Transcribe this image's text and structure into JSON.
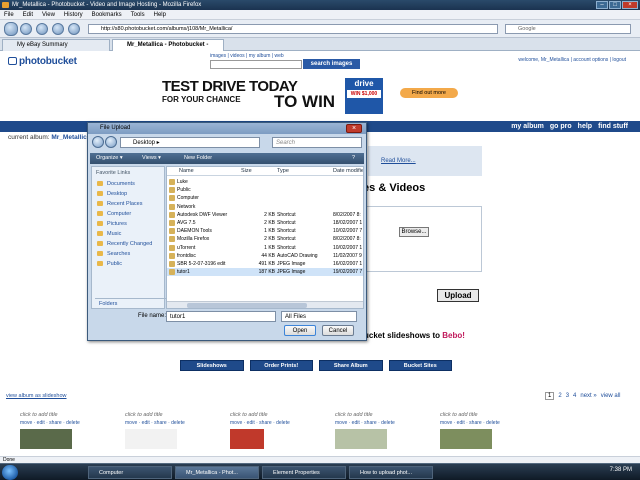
{
  "browser": {
    "window_title": "Mr_Metallica - Photobucket - Video and Image Hosting - Mozilla Firefox",
    "menu": [
      "File",
      "Edit",
      "View",
      "History",
      "Bookmarks",
      "Tools",
      "Help"
    ],
    "url": "http://s80.photobucket.com/albums/j108/Mr_Metallica/",
    "search_placeholder": "Google",
    "tabs": [
      "My eBay Summary",
      "Mr_Metallica - Photobucket - Vid..."
    ],
    "status": "Done"
  },
  "site": {
    "logo": "photobucket",
    "top_links": "images | videos | my album | web",
    "search_button": "search images",
    "welcome": "welcome, Mr_Metallica | account options | logout",
    "nav": [
      "my album",
      "go pro",
      "help",
      "find stuff"
    ],
    "current_album_label": "current album:",
    "current_album": "Mr_Metallica",
    "read_more": "Read More...",
    "videos_heading": "ies & Videos",
    "browse": "Browse...",
    "upload": "Upload",
    "bebo_text": "ucket slideshows to ",
    "bebo_brand": "Bebo!",
    "action_buttons": [
      "Slideshows",
      "Order Prints!",
      "Share Album",
      "Bucket Sites"
    ],
    "view_slideshow": "view album as slideshow",
    "pager": [
      "1",
      "2",
      "3",
      "4",
      "next »",
      "view all"
    ],
    "thumb_title": "click to add title",
    "thumb_ops": "move · edit · share · delete"
  },
  "ad": {
    "line1": "TEST DRIVE TODAY",
    "line2": "FOR YOUR CHANCE",
    "line3": "TO WIN",
    "logo": "drive",
    "logo_sub": "WIN $1,000",
    "cta": "Find out more"
  },
  "dialog": {
    "title": "File Upload",
    "address": "Desktop ▸",
    "search": "Search",
    "toolbar": [
      "Organize ▾",
      "Views ▾",
      "New Folder"
    ],
    "favorites_header": "Favorite Links",
    "favorites": [
      "Documents",
      "Desktop",
      "Recent Places",
      "Computer",
      "Pictures",
      "Music",
      "Recently Changed",
      "Searches",
      "Public"
    ],
    "folders": "Folders",
    "columns": [
      "Name",
      "Size",
      "Type",
      "Date modifie"
    ],
    "files": [
      {
        "name": "Luke",
        "size": "",
        "type": "",
        "date": ""
      },
      {
        "name": "Public",
        "size": "",
        "type": "",
        "date": ""
      },
      {
        "name": "Computer",
        "size": "",
        "type": "",
        "date": ""
      },
      {
        "name": "Network",
        "size": "",
        "type": "",
        "date": ""
      },
      {
        "name": "Autodesk DWF Viewer",
        "size": "2 KB",
        "type": "Shortcut",
        "date": "8/02/2007 8:"
      },
      {
        "name": "AVG 7.5",
        "size": "2 KB",
        "type": "Shortcut",
        "date": "18/02/2007 1"
      },
      {
        "name": "DAEMON Tools",
        "size": "1 KB",
        "type": "Shortcut",
        "date": "10/02/2007 7"
      },
      {
        "name": "Mozilla Firefox",
        "size": "2 KB",
        "type": "Shortcut",
        "date": "8/02/2007 8:"
      },
      {
        "name": "uTorrent",
        "size": "1 KB",
        "type": "Shortcut",
        "date": "10/02/2007 1"
      },
      {
        "name": "frontdisc",
        "size": "44 KB",
        "type": "AutoCAD Drawing",
        "date": "11/02/2007 9"
      },
      {
        "name": "SBR 5-2-07-3196 edit",
        "size": "491 KB",
        "type": "JPEG Image",
        "date": "16/02/2007 1"
      },
      {
        "name": "tutor1",
        "size": "187 KB",
        "type": "JPEG Image",
        "date": "19/02/2007 7"
      }
    ],
    "filename_label": "File name:",
    "filename": "tutor1",
    "filetype": "All Files",
    "open": "Open",
    "cancel": "Cancel"
  },
  "taskbar": {
    "items": [
      "Computer",
      "Mr_Metallica - Phot...",
      "Element Properties",
      "How to upload phot..."
    ],
    "clock": "7:38 PM"
  }
}
